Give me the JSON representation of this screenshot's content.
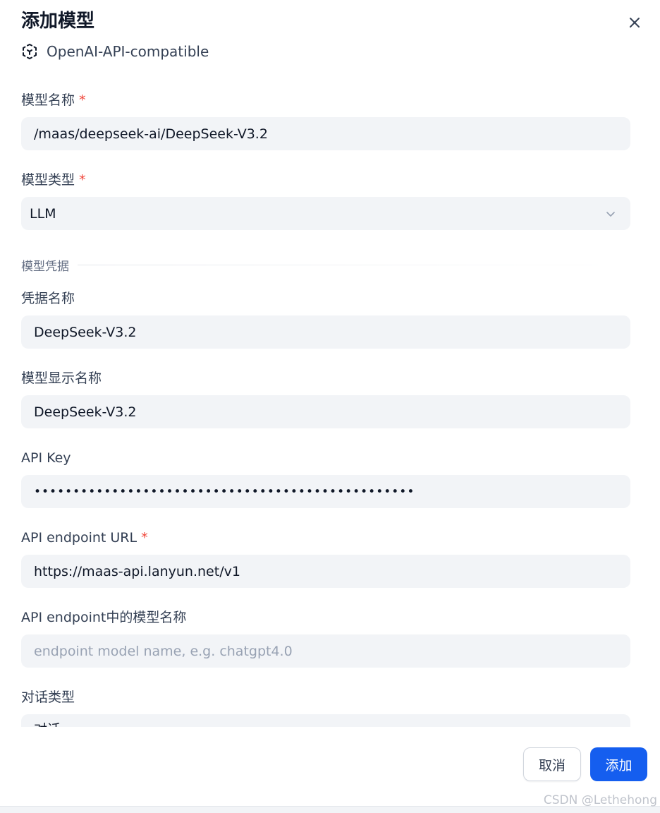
{
  "dialog": {
    "title": "添加模型",
    "provider": "OpenAI-API-compatible",
    "close_icon": "close-icon"
  },
  "fields": {
    "model_name": {
      "label": "模型名称",
      "required_mark": "*",
      "value": "/maas/deepseek-ai/DeepSeek-V3.2"
    },
    "model_type": {
      "label": "模型类型",
      "required_mark": "*",
      "value": "LLM"
    },
    "credentials_section": "模型凭据",
    "credential_name": {
      "label": "凭据名称",
      "value": "DeepSeek-V3.2"
    },
    "display_name": {
      "label": "模型显示名称",
      "value": "DeepSeek-V3.2"
    },
    "api_key": {
      "label": "API Key",
      "value": "•••••••••••••••••••••••••••••••••••••••••••••••••"
    },
    "endpoint_url": {
      "label": "API endpoint URL",
      "required_mark": "*",
      "value": "https://maas-api.lanyun.net/v1"
    },
    "endpoint_model_name": {
      "label": "API endpoint中的模型名称",
      "placeholder": "endpoint model name, e.g. chatgpt4.0"
    },
    "dialogue_type": {
      "label": "对话类型",
      "value": "对话"
    }
  },
  "footer": {
    "cancel_label": "取消",
    "add_label": "添加"
  },
  "watermark": "CSDN @Lethehong",
  "colors": {
    "primary": "#155eef",
    "required": "#f04438",
    "input_bg": "#f2f4f7",
    "text": "#101828",
    "label": "#344054",
    "placeholder": "#98a2b3"
  }
}
